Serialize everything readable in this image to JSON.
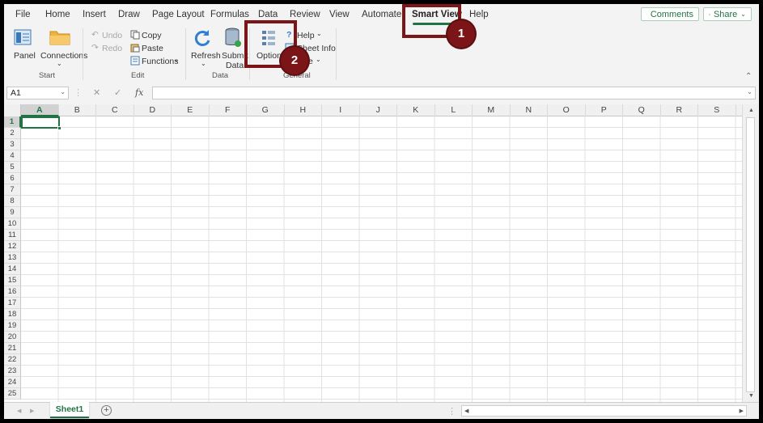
{
  "menu": {
    "items": [
      "File",
      "Home",
      "Insert",
      "Draw",
      "Page Layout",
      "Formulas",
      "Data",
      "Review",
      "View",
      "Automate",
      "Smart View",
      "Help"
    ],
    "active": "Smart View",
    "comments": "Comments",
    "share": "Share"
  },
  "ribbon": {
    "panel": "Panel",
    "connections": "Connections",
    "start_group": "Start",
    "undo": "Undo",
    "redo": "Redo",
    "copy": "Copy",
    "paste": "Paste",
    "functions": "Functions",
    "edit_group": "Edit",
    "refresh": "Refresh",
    "submit_line1": "Submit",
    "submit_line2": "Data",
    "data_group": "Data",
    "options": "Options",
    "help": "Help",
    "sheet_info": "Sheet Info",
    "more_partial": "e",
    "general_group": "General"
  },
  "formula_bar": {
    "name_box": "A1",
    "fx": "fx",
    "formula": ""
  },
  "grid": {
    "columns": [
      "A",
      "B",
      "C",
      "D",
      "E",
      "F",
      "G",
      "H",
      "I",
      "J",
      "K",
      "L",
      "M",
      "N",
      "O",
      "P",
      "Q",
      "R",
      "S"
    ],
    "rows": [
      "1",
      "2",
      "3",
      "4",
      "5",
      "6",
      "7",
      "8",
      "9",
      "10",
      "11",
      "12",
      "13",
      "14",
      "15",
      "16",
      "17",
      "18",
      "19",
      "20",
      "21",
      "22",
      "23",
      "24",
      "25"
    ],
    "selected_cell": "A1"
  },
  "sheets": {
    "tabs": [
      "Sheet1"
    ],
    "add_label": "+"
  },
  "callouts": {
    "one": "1",
    "two": "2"
  },
  "colors": {
    "accent": "#217346",
    "callout": "#7b1517"
  },
  "icons": {
    "panel": "panel-icon",
    "connections": "folder-icon",
    "refresh": "refresh-icon",
    "submit": "database-icon",
    "options": "options-grid-icon"
  }
}
